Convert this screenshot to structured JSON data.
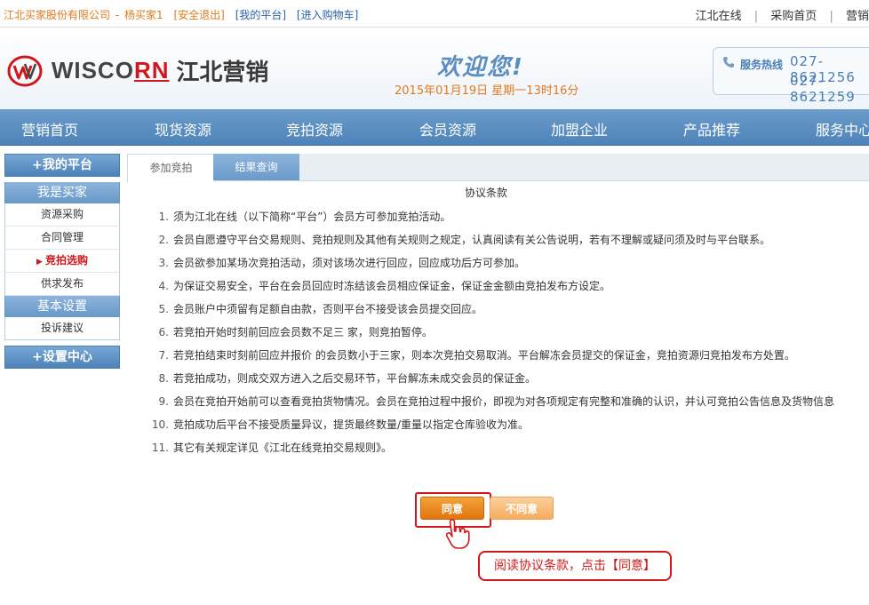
{
  "topbar": {
    "company": "江北买家股份有限公司",
    "separator": "-",
    "buyer": "杨买家1",
    "logout": "[安全退出]",
    "my_platform": "[我的平台]",
    "cart": "[进入购物车]",
    "right_links": [
      "江北在线",
      "采购首页",
      "营销"
    ]
  },
  "header": {
    "logo_brand_a": "WISCO",
    "logo_brand_b": "RN",
    "logo_cn": "江北营销",
    "welcome": "欢迎您!",
    "datetime": "2015年01月19日 星期一13时16分",
    "hotline_label": "服务热线",
    "hotline_numbers": [
      "027-8621256",
      "027-8621259"
    ]
  },
  "nav": [
    "营销首页",
    "现货资源",
    "竞拍资源",
    "会员资源",
    "加盟企业",
    "产品推荐",
    "服务中心"
  ],
  "sidebar": {
    "my_platform": "+我的平台",
    "buyer_section": "我是买家",
    "buyer_items": [
      "资源采购",
      "合同管理",
      "竞拍选购",
      "供求发布"
    ],
    "active_item": "竞拍选购",
    "basic_settings": "基本设置",
    "basic_items": [
      "投诉建议"
    ],
    "settings_center": "+设置中心"
  },
  "content": {
    "tabs": [
      "参加竞拍",
      "结果查询"
    ],
    "terms_title": "协议条款",
    "terms": [
      "须为江北在线（以下简称“平台”）会员方可参加竞拍活动。",
      "会员自愿遵守平台交易规则、竞拍规则及其他有关规则之规定，认真阅读有关公告说明，若有不理解或疑问须及时与平台联系。",
      "会员欲参加某场次竞拍活动，须对该场次进行回应，回应成功后方可参加。",
      "为保证交易安全，平台在会员回应时冻结该会员相应保证金，保证金金额由竞拍发布方设定。",
      "会员账户中须留有足额自由款，否则平台不接受该会员提交回应。",
      "若竞拍开始时刻前回应会员数不足三 家，则竞拍暂停。",
      "若竞拍结束时刻前回应并报价 的会员数小于三家，则本次竞拍交易取消。平台解冻会员提交的保证金，竞拍资源归竞拍发布方处置。",
      "若竞拍成功，则成交双方进入之后交易环节，平台解冻未成交会员的保证金。",
      "会员在竞拍开始前可以查看竞拍货物情况。会员在竞拍过程中报价，即视为对各项规定有完整和准确的认识，并认可竞拍公告信息及货物信息",
      "竞拍成功后平台不接受质量异议，提货最终数量/重量以指定仓库验收为准。",
      "其它有关规定详见《江北在线竞拍交易规则》。"
    ],
    "agree_button": "同意",
    "disagree_button": "不同意",
    "callout": "阅读协议条款，点击【同意】"
  },
  "colors": {
    "accent_orange": "#e07a1f",
    "nav_blue": "#4f83b8",
    "highlight_red": "#d0181c"
  }
}
